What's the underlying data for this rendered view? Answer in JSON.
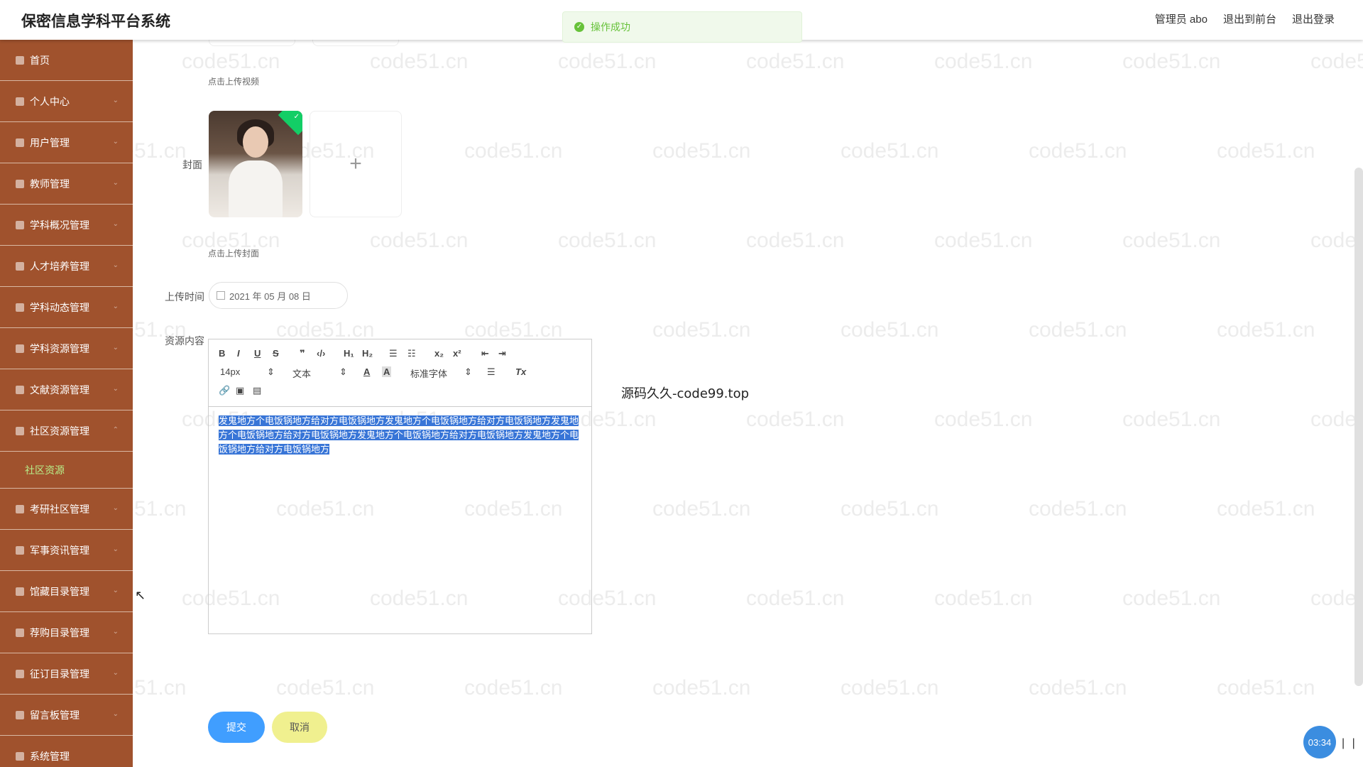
{
  "header": {
    "title": "保密信息学科平台系统",
    "user": "管理员 abo",
    "front_link": "退出到前台",
    "logout": "退出登录"
  },
  "toast": {
    "message": "操作成功"
  },
  "sidebar": {
    "items": [
      {
        "label": "首页"
      },
      {
        "label": "个人中心"
      },
      {
        "label": "用户管理"
      },
      {
        "label": "教师管理"
      },
      {
        "label": "学科概况管理"
      },
      {
        "label": "人才培养管理"
      },
      {
        "label": "学科动态管理"
      },
      {
        "label": "学科资源管理"
      },
      {
        "label": "文献资源管理"
      },
      {
        "label": "社区资源管理"
      }
    ],
    "submenu": "社区资源",
    "items2": [
      {
        "label": "考研社区管理"
      },
      {
        "label": "军事资讯管理"
      },
      {
        "label": "馆藏目录管理"
      },
      {
        "label": "荐购目录管理"
      },
      {
        "label": "征订目录管理"
      },
      {
        "label": "留言板管理"
      },
      {
        "label": "系统管理"
      }
    ]
  },
  "form": {
    "video_tip": "点击上传视频",
    "cover_label": "封面",
    "cover_tip": "点击上传封面",
    "add_symbol": "+",
    "time_label": "上传时间",
    "time_value": "2021 年 05 月 08 日",
    "content_label": "资源内容",
    "toolbar": {
      "bold": "B",
      "italic": "I",
      "underline": "U",
      "strike": "S",
      "quote": "❞",
      "code": "‹/›",
      "h1": "H₁",
      "h2": "H₂",
      "ol": "☰",
      "ul": "☷",
      "sub": "x₂",
      "sup": "x²",
      "indent_less": "⇤",
      "indent_more": "⇥",
      "size": "14px",
      "format": "文本",
      "color": "A",
      "bg": "A",
      "font": "标准字体",
      "align": "☰",
      "clean": "Tx",
      "link": "🔗",
      "image": "▣",
      "video": "▤"
    },
    "content": "发鬼地方个电饭锅地方给对方电饭锅地方发鬼地方个电饭锅地方给对方电饭锅地方发鬼地方个电饭锅地方给对方电饭锅地方发鬼地方个电饭锅地方给对方电饭锅地方发鬼地方个电饭锅地方给对方电饭锅地方",
    "submit": "提交",
    "cancel": "取消"
  },
  "overlay_text": "源码久久-code99.top",
  "watermark": "code51.cn",
  "timer": "03:34",
  "pause": "| |",
  "colors": {
    "sidebar": "#a0522d",
    "primary": "#409eff",
    "success": "#67c23a",
    "cancel": "#f0f08f"
  }
}
